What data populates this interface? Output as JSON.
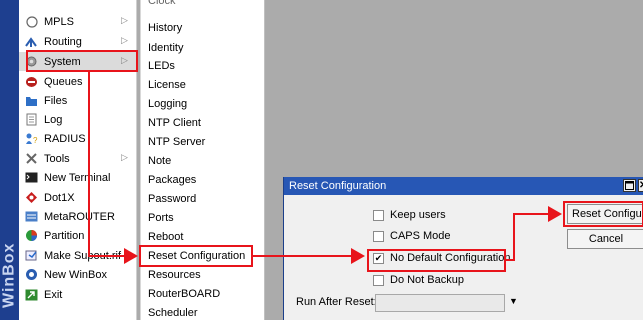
{
  "brand": {
    "text": "WinBox"
  },
  "main_menu": {
    "items": [
      {
        "label": "MPLS",
        "icon": "mpls-icon",
        "has_submenu": true
      },
      {
        "label": "Routing",
        "icon": "routing-icon",
        "has_submenu": true
      },
      {
        "label": "System",
        "icon": "gear-icon",
        "has_submenu": true,
        "selected": true
      },
      {
        "label": "Queues",
        "icon": "queues-icon"
      },
      {
        "label": "Files",
        "icon": "folder-icon"
      },
      {
        "label": "Log",
        "icon": "log-icon"
      },
      {
        "label": "RADIUS",
        "icon": "radius-icon"
      },
      {
        "label": "Tools",
        "icon": "tools-icon",
        "has_submenu": true
      },
      {
        "label": "New Terminal",
        "icon": "terminal-icon"
      },
      {
        "label": "Dot1X",
        "icon": "dot1x-icon"
      },
      {
        "label": "MetaROUTER",
        "icon": "metarouter-icon"
      },
      {
        "label": "Partition",
        "icon": "partition-icon"
      },
      {
        "label": "Make Supout.rif",
        "icon": "supout-icon"
      },
      {
        "label": "New WinBox",
        "icon": "winbox-icon"
      },
      {
        "label": "Exit",
        "icon": "exit-icon"
      }
    ]
  },
  "sub_menu": {
    "partial_label": "Clock",
    "items": [
      "History",
      "Identity",
      "LEDs",
      "License",
      "Logging",
      "NTP Client",
      "NTP Server",
      "Note",
      "Packages",
      "Password",
      "Ports",
      "Reboot",
      "Reset Configuration",
      "Resources",
      "RouterBOARD",
      "Scheduler"
    ]
  },
  "dialog": {
    "title": "Reset Configuration",
    "options": [
      {
        "label": "Keep users",
        "checked": false
      },
      {
        "label": "CAPS Mode",
        "checked": false
      },
      {
        "label": "No Default Configuration",
        "checked": true
      },
      {
        "label": "Do Not Backup",
        "checked": false
      }
    ],
    "run_after_reset_label": "Run After Reset:",
    "run_after_reset_value": "",
    "reset_button": "Reset Configuration",
    "cancel_button": "Cancel"
  },
  "colors": {
    "winbox_strip": "#1e3f8f",
    "title_bar": "#2757b5",
    "annotation": "#e8141b"
  }
}
